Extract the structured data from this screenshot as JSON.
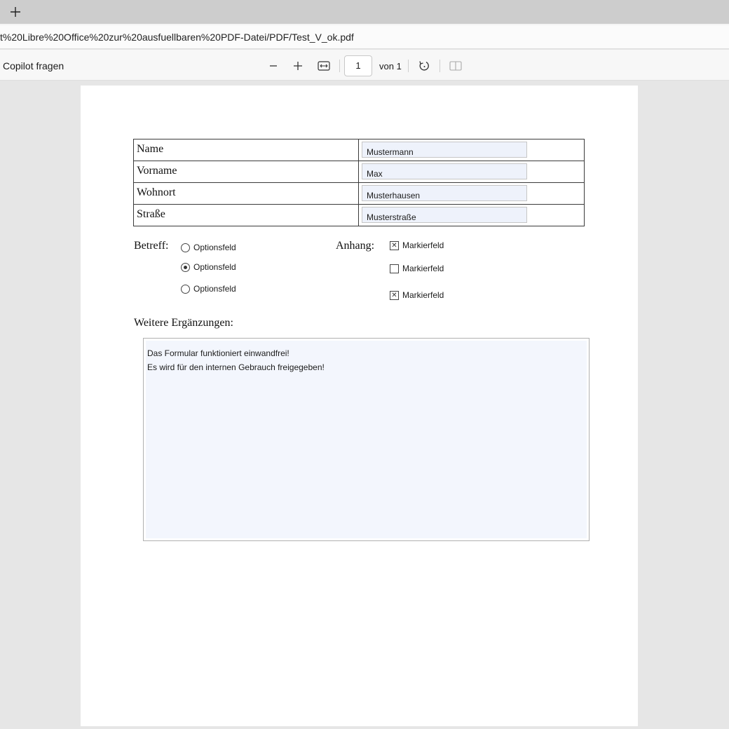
{
  "browser": {
    "new_tab_label": "+",
    "url": "t%20Libre%20Office%20zur%20ausfuellbaren%20PDF-Datei/PDF/Test_V_ok.pdf"
  },
  "toolbar": {
    "copilot_label": "Copilot fragen",
    "page_number": "1",
    "page_total": "von 1"
  },
  "form": {
    "fields": [
      {
        "label": "Name",
        "value": "Mustermann"
      },
      {
        "label": "Vorname",
        "value": "Max"
      },
      {
        "label": "Wohnort",
        "value": "Musterhausen"
      },
      {
        "label": "Straße",
        "value": "Musterstraße"
      }
    ],
    "betreff_label": "Betreff:",
    "radios": [
      {
        "label": "Optionsfeld",
        "selected": false
      },
      {
        "label": "Optionsfeld",
        "selected": true
      },
      {
        "label": "Optionsfeld",
        "selected": false
      }
    ],
    "anhang_label": "Anhang:",
    "checkboxes": [
      {
        "label": "Markierfeld",
        "checked": true
      },
      {
        "label": "Markierfeld",
        "checked": false
      },
      {
        "label": "Markierfeld",
        "checked": true
      }
    ],
    "notes_label": "Weitere Ergänzungen:",
    "notes_lines": [
      "Das Formular funktioniert einwandfrei!",
      "Es wird für den internen Gebrauch freigegeben!"
    ]
  }
}
